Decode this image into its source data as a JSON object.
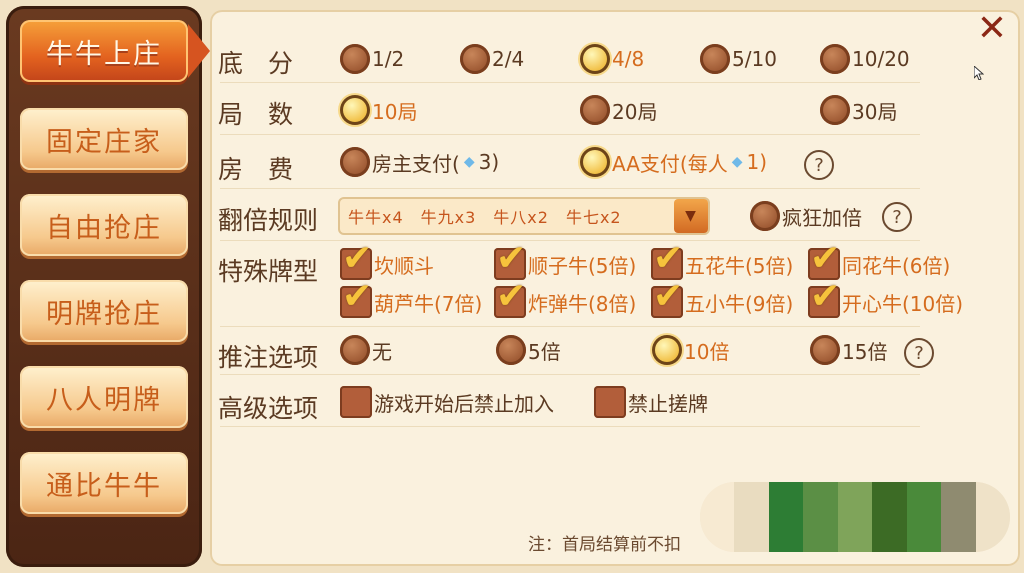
{
  "tabs": [
    {
      "label": "牛牛上庄",
      "active": true
    },
    {
      "label": "固定庄家",
      "active": false
    },
    {
      "label": "自由抢庄",
      "active": false
    },
    {
      "label": "明牌抢庄",
      "active": false
    },
    {
      "label": "八人明牌",
      "active": false
    },
    {
      "label": "通比牛牛",
      "active": false
    }
  ],
  "close_icon": "close-icon",
  "base_score": {
    "label": "底　分",
    "options": [
      "1/2",
      "2/4",
      "4/8",
      "5/10",
      "10/20"
    ],
    "selected": "4/8"
  },
  "rounds": {
    "label": "局　数",
    "options": [
      "10局",
      "20局",
      "30局"
    ],
    "selected": "10局"
  },
  "room_fee": {
    "label": "房　费",
    "owner_pay_prefix": "房主支付(",
    "owner_pay_suffix": " 3)",
    "aa_pay_prefix": "AA支付(每人",
    "aa_pay_suffix": " 1)",
    "selected": "AA"
  },
  "multiplier": {
    "label": "翻倍规则",
    "dropdown_value": "牛牛x4　牛九x3　牛八x2　牛七x2",
    "crazy_label": "疯狂加倍"
  },
  "special": {
    "label": "特殊牌型",
    "items": [
      "坎顺斗",
      "顺子牛(5倍)",
      "五花牛(5倍)",
      "同花牛(6倍)",
      "葫芦牛(7倍)",
      "炸弹牛(8倍)",
      "五小牛(9倍)",
      "开心牛(10倍)"
    ]
  },
  "push_bet": {
    "label": "推注选项",
    "options": [
      "无",
      "5倍",
      "10倍",
      "15倍"
    ],
    "selected": "10倍"
  },
  "advanced": {
    "label": "高级选项",
    "items": [
      "游戏开始后禁止加入",
      "禁止搓牌"
    ]
  },
  "note": "注：首局结算前不扣",
  "help_symbol": "?",
  "colors": {
    "accent": "#d56c1e",
    "text": "#5b3a22",
    "panel": "#faf1de"
  }
}
